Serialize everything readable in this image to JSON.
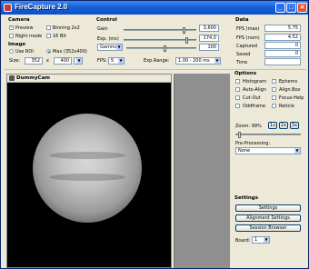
{
  "window": {
    "title": "FireCapture 2.0",
    "minimize": "_",
    "maximize": "□",
    "close": "✕"
  },
  "camera": {
    "title": "Camera",
    "preview": "Preview",
    "binning": "Binning 2x2",
    "night_mode": "Night mode",
    "bit16": "16 Bit"
  },
  "image": {
    "title": "Image",
    "use_roi": "Use ROI",
    "max": "Max (352x400)",
    "size_label": "Size:",
    "width": "352",
    "x": "x",
    "height": "400"
  },
  "control": {
    "title": "Control",
    "gain_label": "Gain",
    "gain_value": "3,600",
    "gain_level": 0.85,
    "exp_label": "Exp. (ms)",
    "exp_value": "174.0",
    "exp_level": 0.88,
    "gamma_label": "Gamma",
    "gamma_value": "100",
    "gamma_level": 0.55,
    "fps_label": "FPS:",
    "fps_value": "5",
    "exp_range_label": "Exp.Range:",
    "exp_range_value": "1.00 - 200 ms"
  },
  "data": {
    "title": "Data",
    "fps_max_label": "FPS (max)",
    "fps_max_value": "5.75",
    "fps_nom_label": "FPS (nom)",
    "fps_nom_value": "4.52",
    "captured_label": "Captured",
    "captured_value": "0",
    "saved_label": "Saved",
    "saved_value": "0",
    "time_label": "Time",
    "time_value": ""
  },
  "options": {
    "title": "Options",
    "histogram": "Histogram",
    "ephems": "Ephems",
    "auto_align": "Auto-Align",
    "align_box": "Align.Box",
    "cut_out": "Cut-Out",
    "focus_help": "Focus-Help",
    "oddframe": "Oddframe",
    "reticle": "Reticle",
    "zoom_label": "Zoom: 99%",
    "zoom_1x": "1x",
    "zoom_2x": "2x",
    "zoom_3x": "3x",
    "preproc_label": "Pre-Processing:",
    "preproc_value": "None"
  },
  "settings": {
    "title": "Settings",
    "settings_btn": "Settings",
    "alignment_btn": "Alignment Settings",
    "session_btn": "Session Browser",
    "board_label": "Board:",
    "board_value": "1"
  },
  "cam_window": {
    "title": "DummyCam"
  }
}
